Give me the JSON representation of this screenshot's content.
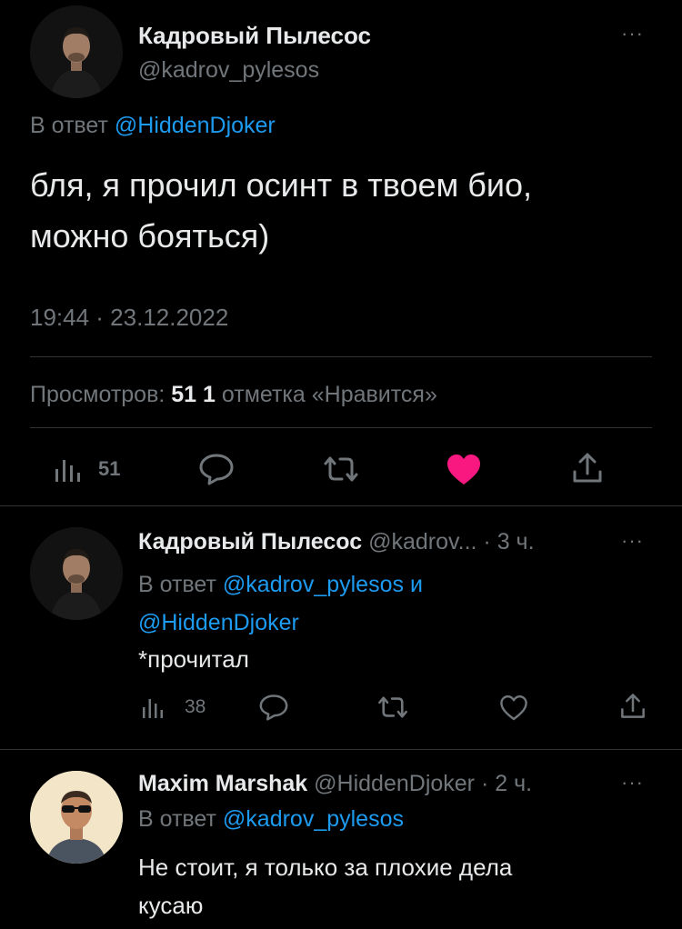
{
  "main_tweet": {
    "author_name": "Кадровый Пылесос",
    "author_handle": "@kadrov_pylesos",
    "reply_prefix": "В ответ",
    "reply_to": "@HiddenDjoker",
    "text_line1": "бля, я прочил осинт в твоем био,",
    "text_line2": "можно бояться)",
    "timestamp": "19:44 · 23.12.2022",
    "stats": {
      "views_label": "Просмотров:",
      "views_count": "51",
      "likes_count": "1",
      "likes_label": "отметка «Нравится»"
    },
    "actions": {
      "views_count": "51",
      "liked": true,
      "like_color": "#f91880"
    },
    "more": "···"
  },
  "replies": [
    {
      "author_name": "Кадровый Пылесос",
      "author_handle": "@kadrov...",
      "time": "· 3 ч.",
      "reply_prefix": "В ответ",
      "reply_to_1": "@kadrov_pylesos",
      "reply_conj": "и",
      "reply_to_2": "@HiddenDjoker",
      "text": "*прочитал",
      "views_count": "38",
      "more": "···"
    },
    {
      "author_name": "Maxim Marshak",
      "author_handle": "@HiddenDjoker",
      "time": "· 2 ч.",
      "reply_prefix": "В ответ",
      "reply_to_1": "@kadrov_pylesos",
      "text_line1": "Не стоит, я только за плохие дела",
      "text_line2": "кусаю",
      "more": "···"
    }
  ],
  "colors": {
    "background": "#000000",
    "text": "#e7e9ea",
    "secondary": "#71767b",
    "link": "#1d9bf0",
    "divider": "#2f3336"
  },
  "icons": [
    "views-icon",
    "reply-icon",
    "retweet-icon",
    "like-icon",
    "share-icon",
    "more-icon"
  ]
}
